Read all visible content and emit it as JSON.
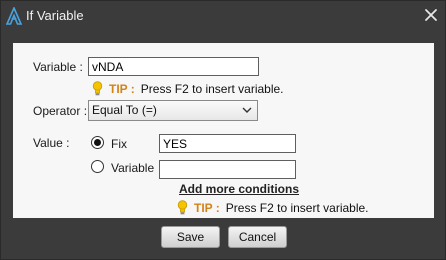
{
  "window": {
    "title": "If Variable",
    "close_icon": "close-x-icon",
    "app_icon": "app-logo-icon"
  },
  "form": {
    "variable_label": "Variable :",
    "variable_value": "vNDA",
    "tip1": {
      "icon": "lightbulb-icon",
      "tip_word": "TIP :",
      "text": "Press F2 to insert variable."
    },
    "operator_label": "Operator :",
    "operator_selected": "Equal To (=)",
    "value_label": "Value :",
    "fix_option_label": "Fix",
    "fix_checked": true,
    "fix_value": "YES",
    "variable_option_label": "Variable",
    "variable_option_checked": false,
    "variable_option_value": "",
    "add_conditions_link": "Add more conditions",
    "tip2": {
      "icon": "lightbulb-icon",
      "tip_word": "TIP :",
      "text": "Press F2 to insert variable."
    }
  },
  "buttons": {
    "save": "Save",
    "cancel": "Cancel"
  },
  "colors": {
    "titlebar": "#3b3b3b",
    "panel": "#f7f7f7",
    "tip_accent": "#d38318"
  }
}
